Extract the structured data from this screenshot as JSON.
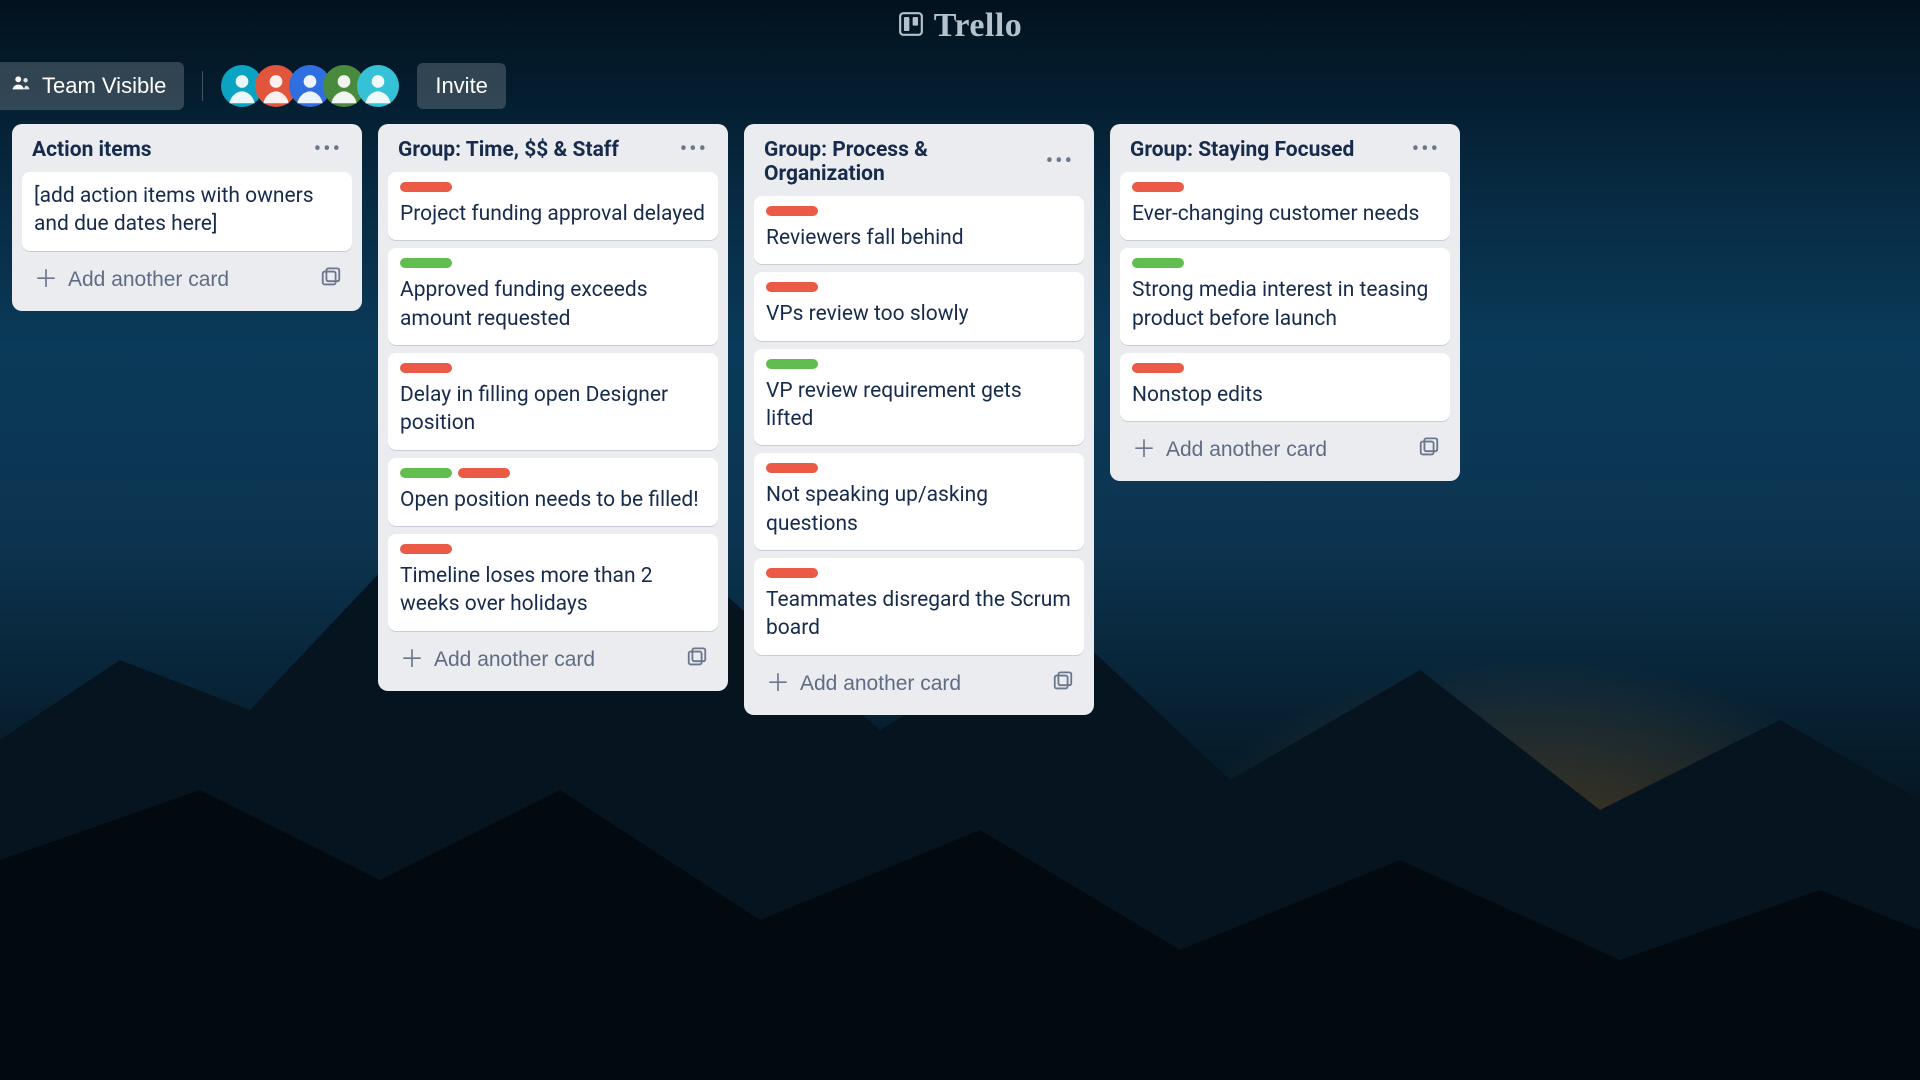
{
  "brand": {
    "name": "Trello"
  },
  "header": {
    "visibility_label": "Team Visible",
    "invite_label": "Invite",
    "avatars": [
      {
        "bg": "#0aa3c2"
      },
      {
        "bg": "#e2553d"
      },
      {
        "bg": "#2f6fe0"
      },
      {
        "bg": "#4a8a3d"
      },
      {
        "bg": "#35c1d6"
      }
    ]
  },
  "add_card_label": "Add another card",
  "label_colors": {
    "red": "#eb5a46",
    "green": "#61bd4f"
  },
  "lists": [
    {
      "title": "Action items",
      "cards": [
        {
          "labels": [],
          "title": "[add action items with owners and due dates here]"
        }
      ]
    },
    {
      "title": "Group: Time, $$ & Staff",
      "cards": [
        {
          "labels": [
            "red"
          ],
          "title": "Project funding approval delayed"
        },
        {
          "labels": [
            "green"
          ],
          "title": "Approved funding exceeds amount requested"
        },
        {
          "labels": [
            "red"
          ],
          "title": "Delay in filling open Designer position"
        },
        {
          "labels": [
            "green",
            "red"
          ],
          "title": "Open position needs to be filled!"
        },
        {
          "labels": [
            "red"
          ],
          "title": "Timeline loses more than 2 weeks over holidays"
        }
      ]
    },
    {
      "title": "Group: Process & Organization",
      "cards": [
        {
          "labels": [
            "red"
          ],
          "title": "Reviewers fall behind"
        },
        {
          "labels": [
            "red"
          ],
          "title": "VPs review too slowly"
        },
        {
          "labels": [
            "green"
          ],
          "title": "VP review requirement gets lifted"
        },
        {
          "labels": [
            "red"
          ],
          "title": "Not speaking up/asking questions"
        },
        {
          "labels": [
            "red"
          ],
          "title": "Teammates disregard the Scrum board"
        }
      ]
    },
    {
      "title": "Group: Staying Focused",
      "cards": [
        {
          "labels": [
            "red"
          ],
          "title": "Ever-changing customer needs"
        },
        {
          "labels": [
            "green"
          ],
          "title": "Strong media interest in teasing product before launch"
        },
        {
          "labels": [
            "red"
          ],
          "title": "Nonstop edits"
        }
      ]
    }
  ]
}
